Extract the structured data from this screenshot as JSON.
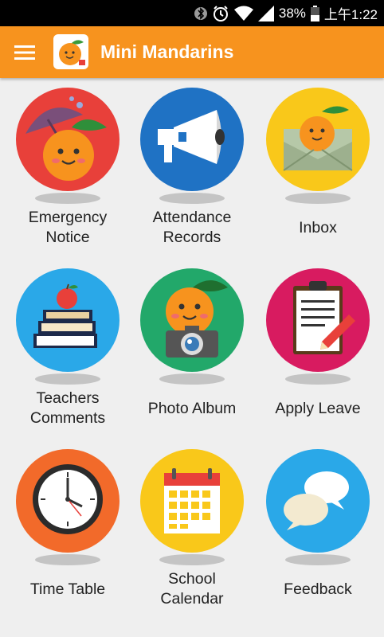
{
  "status_bar": {
    "battery": "38%",
    "time": "上午1:22"
  },
  "app_bar": {
    "title": "Mini Mandarins"
  },
  "tiles": [
    {
      "label": "Emergency Notice",
      "icon": "umbrella-mandarin-icon",
      "color": "#e8403a"
    },
    {
      "label": "Attendance Records",
      "icon": "megaphone-icon",
      "color": "#1f72c4"
    },
    {
      "label": "Inbox",
      "icon": "envelope-mandarin-icon",
      "color": "#f9c81a"
    },
    {
      "label": "Teachers Comments",
      "icon": "books-apple-icon",
      "color": "#2aa8e8"
    },
    {
      "label": "Photo Album",
      "icon": "camera-mandarin-icon",
      "color": "#22a86a"
    },
    {
      "label": "Apply Leave",
      "icon": "clipboard-pencil-icon",
      "color": "#d81b60"
    },
    {
      "label": "Time Table",
      "icon": "clock-icon",
      "color": "#f26a2a"
    },
    {
      "label": "School Calendar",
      "icon": "calendar-icon",
      "color": "#f9c81a"
    },
    {
      "label": "Feedback",
      "icon": "chat-bubbles-icon",
      "color": "#2aa8e8"
    }
  ]
}
